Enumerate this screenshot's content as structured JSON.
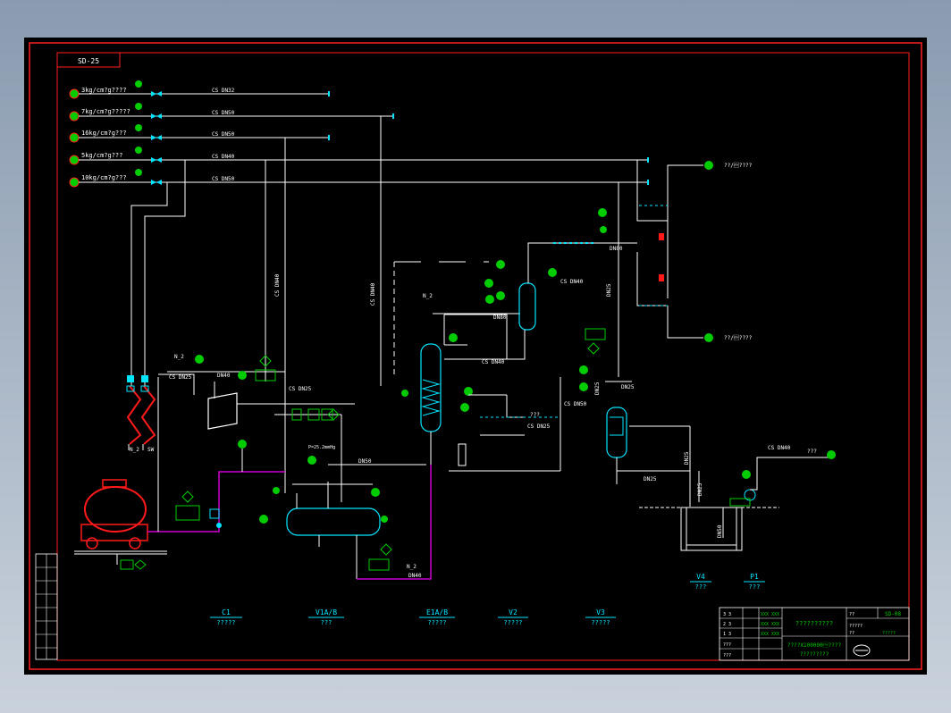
{
  "drawing_code": "SD-25",
  "supply_lines": [
    {
      "label": "3kg/cm?g????",
      "pipe": "CS DN32"
    },
    {
      "label": "7kg/cm?g?????",
      "pipe": "CS DN50"
    },
    {
      "label": "16kg/cm?g???",
      "pipe": "CS DN50"
    },
    {
      "label": "5kg/cm?g???",
      "pipe": "CS DN40"
    },
    {
      "label": "10kg/cm?g???",
      "pipe": "CS DN50"
    }
  ],
  "pipe_labels": {
    "cs_dn40_v1": "CS DN40",
    "cs_dn40_v2": "CS DN40",
    "cs_dn25_a": "CS DN25",
    "cs_dn25_b": "CS DN25",
    "cs_dn25_c": "CS DN25",
    "cs_dn40_mid": "CS DN40",
    "cs_dn40_top": "CS DN40",
    "cs_dn50_mid": "CS DN50",
    "cs_dn40_right": "CS DN40",
    "dn50_low": "DN50",
    "dn40_low": "DN40",
    "dn40_top": "DN40",
    "dn80_a": "DN80",
    "dn80_b": "DN80",
    "dn25_a": "DN25",
    "dn25_b": "DN25",
    "dn25_c": "DN25",
    "dn25_d": "DN25",
    "dn25_e": "DN25",
    "dn25_f": "DN25",
    "dn50_pit": "DN50"
  },
  "utility_labels": {
    "n2_a": "N_2",
    "n2_b": "N_2",
    "n2_c": "N_2",
    "n2_d": "N_2",
    "sw": "SW"
  },
  "right_outlets": {
    "top": "??/\u0002????",
    "bottom": "??/\u0002????",
    "mid": "???"
  },
  "vessel_note": "P=25.2mmHg",
  "equipment": [
    {
      "tag": "C1",
      "name": "?????"
    },
    {
      "tag": "V1A/B",
      "name": "???"
    },
    {
      "tag": "E1A/B",
      "name": "?????"
    },
    {
      "tag": "V2",
      "name": "?????"
    },
    {
      "tag": "V3",
      "name": "?????"
    },
    {
      "tag": "V4",
      "name": "???"
    },
    {
      "tag": "P1",
      "name": "???"
    }
  ],
  "title_block": {
    "title": "??????????",
    "subtitle": "????X100000\u0002????",
    "subtitle2": "?????????",
    "drawing_no": "SD-08",
    "rows": [
      "3 3",
      "2 3",
      "1 3",
      "???",
      "???"
    ],
    "cells": [
      "XXX XXX",
      "XXX XXX",
      "XXX XXX"
    ],
    "side": [
      "??",
      "?????",
      "??",
      "?????"
    ]
  },
  "colors": {
    "background": "#000000",
    "border": "#ff2020",
    "line": "#ffffff",
    "instrument": "#00cc00",
    "symbol": "#00e5ff",
    "text": "#ffffff",
    "magenta": "#cc00cc",
    "equipment": "#ff1a1a"
  }
}
